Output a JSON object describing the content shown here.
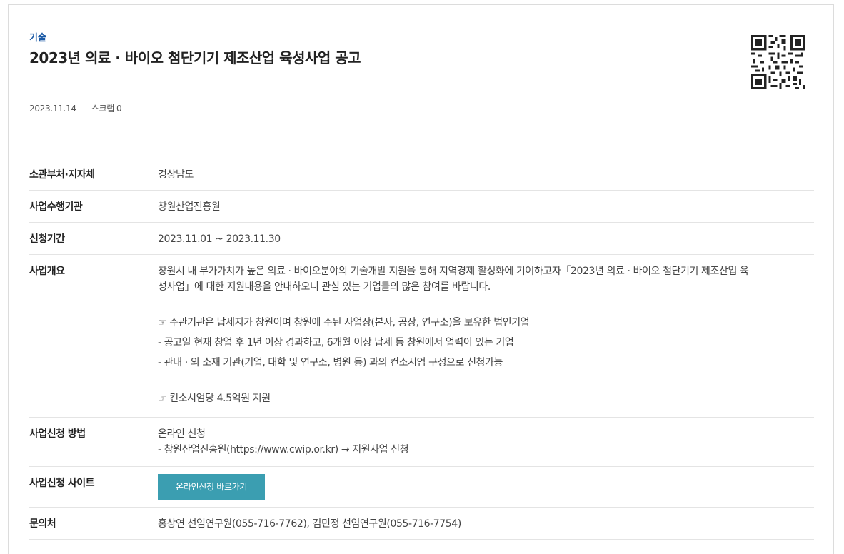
{
  "header": {
    "category": "기술",
    "title": "2023년 의료 · 바이오 첨단기기 제조산업 육성사업 공고",
    "date": "2023.11.14",
    "scrap_label": "스크랩",
    "scrap_count": "0"
  },
  "details": {
    "ministry": {
      "label": "소관부처·지자체",
      "value": "경상남도"
    },
    "agency": {
      "label": "사업수행기관",
      "value": "창원산업진흥원"
    },
    "period": {
      "label": "신청기간",
      "value": "2023.11.01 ~ 2023.11.30"
    },
    "overview": {
      "label": "사업개요",
      "line1": "창원시 내 부가가치가 높은 의료 · 바이오분야의 기술개발 지원을 통해 지역경제 활성화에 기여하고자「2023년 의료 · 바이오 첨단기기 제조산업 육",
      "line2": "성사업」에 대한 지원내용을 안내하오니 관심 있는 기업들의 많은 참여를 바랍니다.",
      "line3": "☞ 주관기관은 납세지가 창원이며 창원에 주된 사업장(본사, 공장, 연구소)을 보유한 법인기업",
      "line4": "- 공고일 현재 창업 후 1년 이상 경과하고, 6개월 이상 납세 등 창원에서 업력이 있는 기업",
      "line5": "- 관내 · 외 소재 기관(기업, 대학 및 연구소, 병원 등) 과의 컨소시엄 구성으로 신청가능",
      "line6": "☞ 컨소시엄당 4.5억원 지원"
    },
    "method": {
      "label": "사업신청 방법",
      "line1": "온라인 신청",
      "line2": "- 창원산업진흥원(https://www.cwip.or.kr) → 지원사업 신청"
    },
    "site": {
      "label": "사업신청 사이트",
      "button": "온라인신청 바로가기"
    },
    "contact": {
      "label": "문의처",
      "value": "홍상연 선임연구원(055-716-7762), 김민정 선임연구원(055-716-7754)"
    }
  },
  "colors": {
    "accent": "#3b9eb1",
    "category": "#1b5aa6"
  },
  "icons": {
    "qr": "qr-code-icon"
  }
}
